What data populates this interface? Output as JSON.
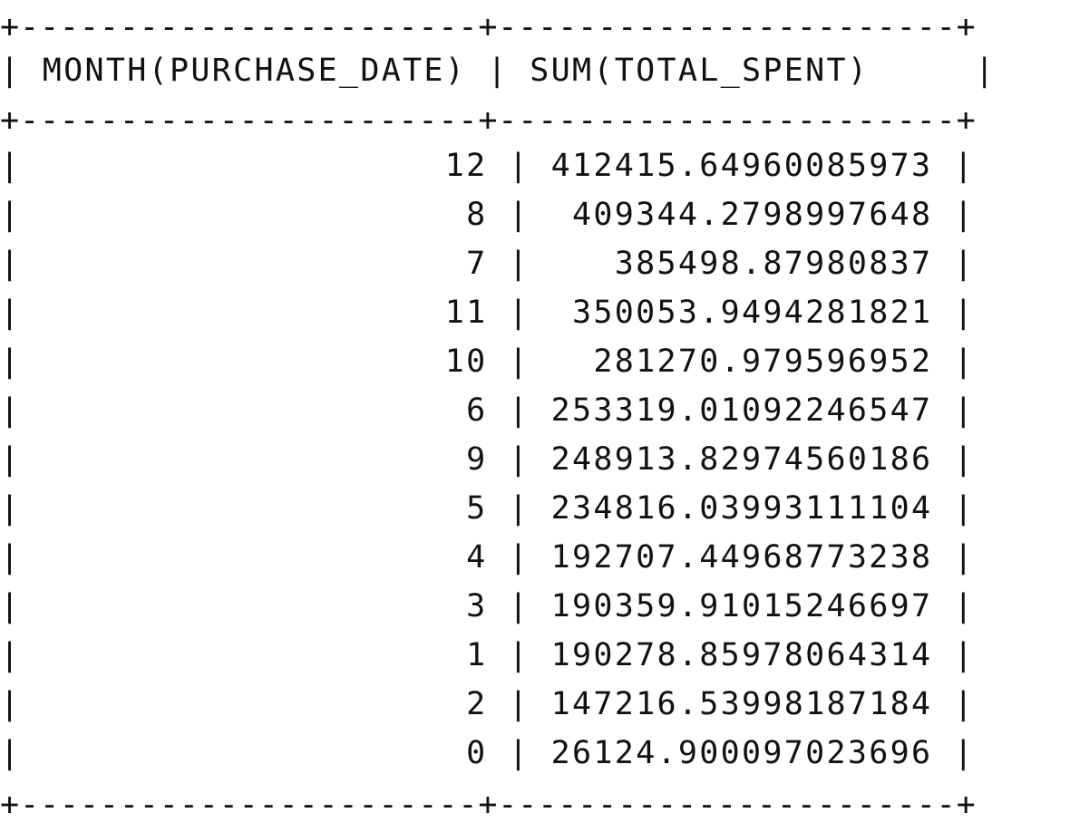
{
  "query_result": {
    "separator": "+-----------------------+-----------------------+",
    "header_line": "| MONTH(PURCHASE_DATE) | SUM(TOTAL_SPENT)     |",
    "columns": [
      "MONTH(PURCHASE_DATE)",
      "SUM(TOTAL_SPENT)"
    ],
    "rows": [
      {
        "month": "12",
        "total": "412415.64960085973",
        "line": "|                    12 | 412415.64960085973 |"
      },
      {
        "month": "8",
        "total": "409344.2798997648",
        "line": "|                     8 |  409344.2798997648 |"
      },
      {
        "month": "7",
        "total": "385498.87980837",
        "line": "|                     7 |    385498.87980837 |"
      },
      {
        "month": "11",
        "total": "350053.9494281821",
        "line": "|                    11 |  350053.9494281821 |"
      },
      {
        "month": "10",
        "total": "281270.979596952",
        "line": "|                    10 |   281270.979596952 |"
      },
      {
        "month": "6",
        "total": "253319.01092246547",
        "line": "|                     6 | 253319.01092246547 |"
      },
      {
        "month": "9",
        "total": "248913.82974560186",
        "line": "|                     9 | 248913.82974560186 |"
      },
      {
        "month": "5",
        "total": "234816.03993111104",
        "line": "|                     5 | 234816.03993111104 |"
      },
      {
        "month": "4",
        "total": "192707.44968773238",
        "line": "|                     4 | 192707.44968773238 |"
      },
      {
        "month": "3",
        "total": "190359.91015246697",
        "line": "|                     3 | 190359.91015246697 |"
      },
      {
        "month": "1",
        "total": "190278.85978064314",
        "line": "|                     1 | 190278.85978064314 |"
      },
      {
        "month": "2",
        "total": "147216.53998187184",
        "line": "|                     2 | 147216.53998187184 |"
      },
      {
        "month": "0",
        "total": "26124.900097023696",
        "line": "|                     0 | 26124.900097023696 |"
      }
    ]
  }
}
